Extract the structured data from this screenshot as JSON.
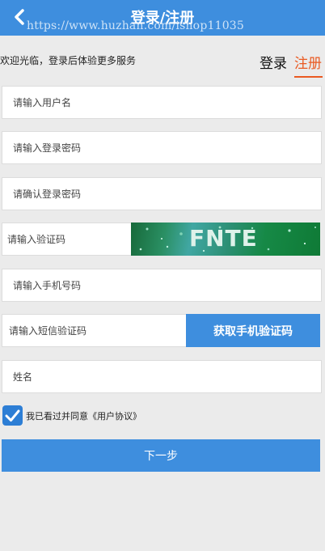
{
  "header": {
    "title": "登录/注册",
    "watermark": "https://www.huzhan.com/ishop11035",
    "back_icon": "chevron-left-icon"
  },
  "welcome_text": "欢迎光临，登录后体验更多服务",
  "tabs": {
    "login": "登录",
    "register": "注册",
    "active": "register",
    "accent_color": "#ea5a22"
  },
  "form": {
    "username_placeholder": "请输入用户名",
    "password_placeholder": "请输入登录密码",
    "confirm_password_placeholder": "请确认登录密码",
    "captcha_placeholder": "请输入验证码",
    "captcha_text": "FNTE",
    "phone_placeholder": "请输入手机号码",
    "sms_code_placeholder": "请输入短信验证码",
    "sms_button_label": "获取手机验证码",
    "name_placeholder": "姓名"
  },
  "agreement": {
    "checked": true,
    "prefix": "我已看过并同意",
    "link_text": "《用户协议》"
  },
  "next_button_label": "下一步",
  "colors": {
    "primary": "#3e8ede",
    "background": "#ebebeb"
  }
}
